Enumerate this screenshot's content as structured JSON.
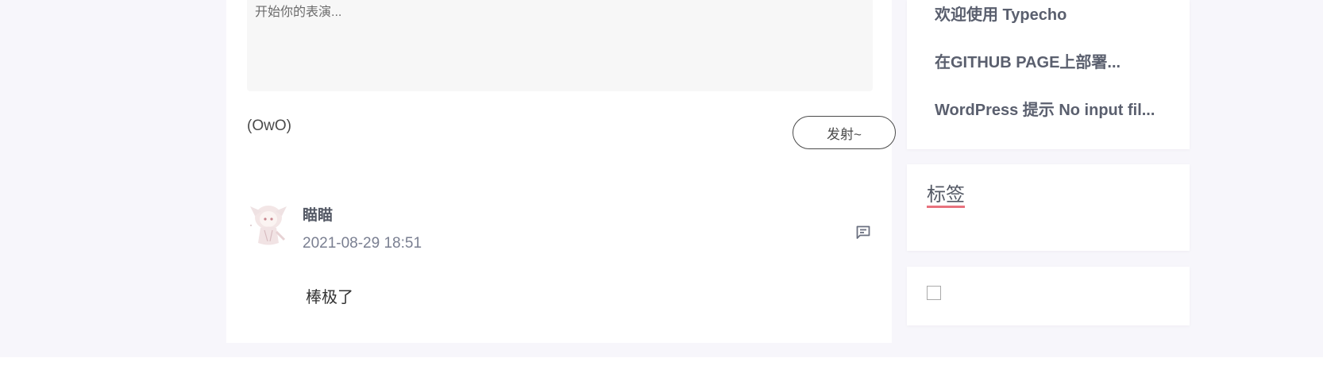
{
  "comment_form": {
    "placeholder": "开始你的表演...",
    "owo_label": "(OwO)",
    "submit_label": "发射~"
  },
  "comments": [
    {
      "author": "瞄瞄",
      "time": "2021-08-29 18:51",
      "content": "棒极了",
      "avatar_icon": "anime-avatar"
    }
  ],
  "sidebar": {
    "recent_posts": [
      {
        "title": "欢迎使用 Typecho"
      },
      {
        "title": "在GITHUB PAGE上部署..."
      },
      {
        "title": "WordPress 提示 No input fil..."
      }
    ],
    "tags": {
      "title": "标签",
      "accent_color": "#e8727d"
    }
  },
  "colors": {
    "page_background": "#f7f6fb",
    "card_background": "#ffffff",
    "input_background": "#f7f7f7",
    "tag_underline": "#e8727d"
  }
}
